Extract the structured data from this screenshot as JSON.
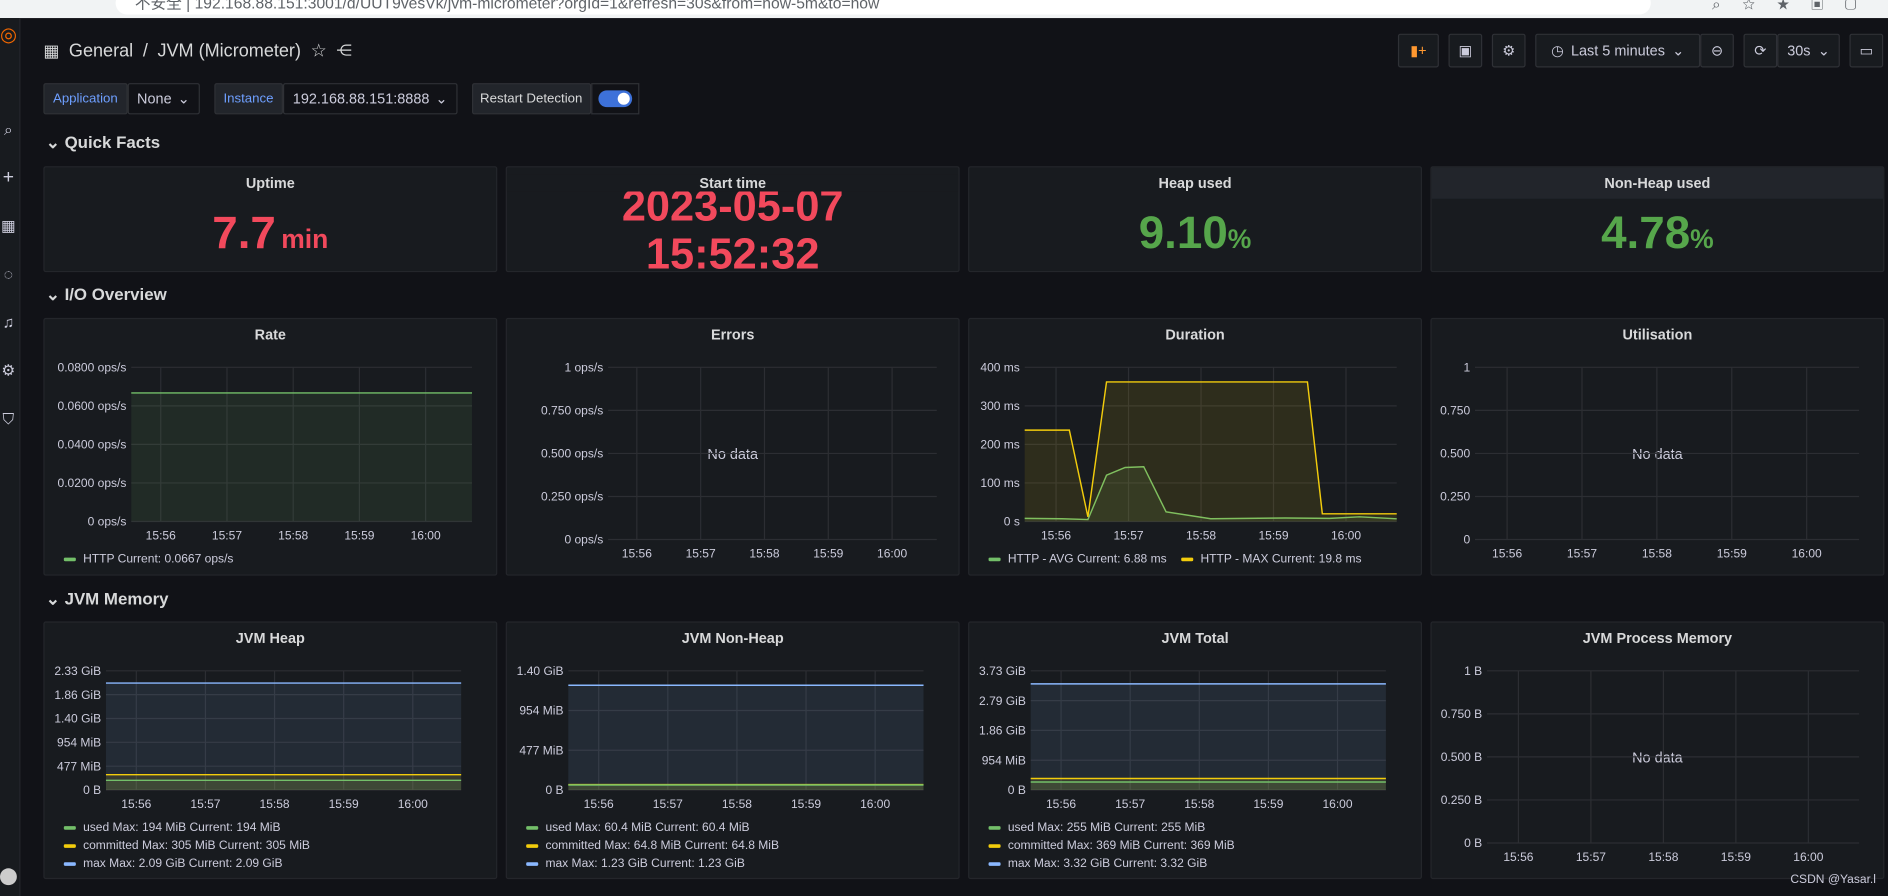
{
  "browser": {
    "url_text": "不安全 | 192.168.88.151:3001/d/UUT9vesVk/jvm-micrometer?orgId=1&refresh=30s&from=now-5m&to=now"
  },
  "sidebar_icons": [
    "grafana-logo-icon",
    "search-icon",
    "plus-icon",
    "dashboards-icon",
    "explore-icon",
    "alerting-icon",
    "settings-icon",
    "shield-icon"
  ],
  "header": {
    "folder": "General",
    "separator": "/",
    "title": "JVM (Micrometer)",
    "time_range": "Last 5 minutes",
    "refresh": "30s"
  },
  "variables": [
    {
      "label": "Application",
      "value": "None"
    },
    {
      "label": "Instance",
      "value": "192.168.88.151:8888"
    }
  ],
  "restart_detection": {
    "label": "Restart Detection",
    "enabled": true
  },
  "rows": {
    "quick_facts": "Quick Facts",
    "io": "I/O Overview",
    "memory": "JVM Memory"
  },
  "quick_facts": [
    {
      "title": "Uptime",
      "value": "7.7",
      "unit": "min",
      "color": "#f2495c"
    },
    {
      "title": "Start time",
      "value_line1": "2023-05-07",
      "value_line2": "15:52:32",
      "color": "#f2495c"
    },
    {
      "title": "Heap used",
      "value": "9.10",
      "unit": "%",
      "color": "#56a64b"
    },
    {
      "title": "Non-Heap used",
      "value": "4.78",
      "unit": "%",
      "color": "#56a64b"
    }
  ],
  "no_data_text": "No data",
  "colors": {
    "green": "#73bf69",
    "yellow": "#f2cc0c",
    "cyan": "#8ab8ff",
    "red": "#f2495c"
  },
  "charts": [
    {
      "id": "rate",
      "title": "Rate",
      "type": "line",
      "x_ticks": [
        "15:56",
        "15:57",
        "15:58",
        "15:59",
        "16:00"
      ],
      "y_ticks": [
        "0.0800 ops/s",
        "0.0600 ops/s",
        "0.0400 ops/s",
        "0.0200 ops/s",
        "0 ops/s"
      ],
      "ylim": [
        0,
        0.08
      ],
      "series": [
        {
          "name": "HTTP",
          "legend": "HTTP  Current: 0.0667 ops/s",
          "color": "#73bf69",
          "fill": true,
          "points": [
            [
              0,
              0.0667
            ],
            [
              1,
              0.0667
            ]
          ]
        }
      ]
    },
    {
      "id": "errors",
      "title": "Errors",
      "type": "line",
      "nodata": true,
      "x_ticks": [
        "15:56",
        "15:57",
        "15:58",
        "15:59",
        "16:00"
      ],
      "y_ticks": [
        "1 ops/s",
        "0.750 ops/s",
        "0.500 ops/s",
        "0.250 ops/s",
        "0 ops/s"
      ],
      "series": []
    },
    {
      "id": "duration",
      "title": "Duration",
      "type": "line",
      "x_ticks": [
        "15:56",
        "15:57",
        "15:58",
        "15:59",
        "16:00"
      ],
      "y_ticks": [
        "400 ms",
        "300 ms",
        "200 ms",
        "100 ms",
        "0 s"
      ],
      "ylim": [
        0,
        400
      ],
      "series": [
        {
          "name": "HTTP - AVG",
          "legend": "HTTP - AVG  Current: 6.88 ms",
          "color": "#73bf69",
          "fill": true,
          "points": [
            [
              0,
              8
            ],
            [
              0.1,
              7
            ],
            [
              0.17,
              5
            ],
            [
              0.22,
              120
            ],
            [
              0.27,
              140
            ],
            [
              0.32,
              142
            ],
            [
              0.38,
              25
            ],
            [
              0.5,
              7
            ],
            [
              0.7,
              9
            ],
            [
              0.82,
              8
            ],
            [
              0.9,
              12
            ],
            [
              1,
              6.88
            ]
          ]
        },
        {
          "name": "HTTP - MAX",
          "legend": "HTTP - MAX  Current: 19.8 ms",
          "color": "#f2cc0c",
          "fill": true,
          "points": [
            [
              0,
              237
            ],
            [
              0.12,
              237
            ],
            [
              0.17,
              12
            ],
            [
              0.22,
              362
            ],
            [
              0.76,
              362
            ],
            [
              0.8,
              20
            ],
            [
              1,
              19.8
            ]
          ]
        }
      ]
    },
    {
      "id": "utilisation",
      "title": "Utilisation",
      "type": "line",
      "nodata": true,
      "x_ticks": [
        "15:56",
        "15:57",
        "15:58",
        "15:59",
        "16:00"
      ],
      "y_ticks": [
        "1",
        "0.750",
        "0.500",
        "0.250",
        "0"
      ],
      "series": []
    },
    {
      "id": "jvm_heap",
      "title": "JVM Heap",
      "type": "area",
      "x_ticks": [
        "15:56",
        "15:57",
        "15:58",
        "15:59",
        "16:00"
      ],
      "y_ticks": [
        "2.33 GiB",
        "1.86 GiB",
        "1.40 GiB",
        "954 MiB",
        "477 MiB",
        "0 B"
      ],
      "ylim": [
        0,
        2.33
      ],
      "series": [
        {
          "name": "used",
          "legend": "used  Max: 194 MiB  Current: 194 MiB",
          "color": "#73bf69",
          "value": 0.19
        },
        {
          "name": "committed",
          "legend": "committed  Max: 305 MiB  Current: 305 MiB",
          "color": "#f2cc0c",
          "value": 0.3
        },
        {
          "name": "max",
          "legend": "max  Max: 2.09 GiB  Current: 2.09 GiB",
          "color": "#8ab8ff",
          "value": 2.09
        }
      ]
    },
    {
      "id": "jvm_nonheap",
      "title": "JVM Non-Heap",
      "type": "area",
      "x_ticks": [
        "15:56",
        "15:57",
        "15:58",
        "15:59",
        "16:00"
      ],
      "y_ticks": [
        "1.40 GiB",
        "954 MiB",
        "477 MiB",
        "0 B"
      ],
      "ylim": [
        0,
        1.4
      ],
      "series": [
        {
          "name": "used",
          "legend": "used  Max: 60.4 MiB  Current: 60.4 MiB",
          "color": "#73bf69",
          "value": 0.059
        },
        {
          "name": "committed",
          "legend": "committed  Max: 64.8 MiB  Current: 64.8 MiB",
          "color": "#f2cc0c",
          "value": 0.063
        },
        {
          "name": "max",
          "legend": "max  Max: 1.23 GiB  Current: 1.23 GiB",
          "color": "#8ab8ff",
          "value": 1.23
        }
      ]
    },
    {
      "id": "jvm_total",
      "title": "JVM Total",
      "type": "area",
      "x_ticks": [
        "15:56",
        "15:57",
        "15:58",
        "15:59",
        "16:00"
      ],
      "y_ticks": [
        "3.73 GiB",
        "2.79 GiB",
        "1.86 GiB",
        "954 MiB",
        "0 B"
      ],
      "ylim": [
        0,
        3.73
      ],
      "series": [
        {
          "name": "used",
          "legend": "used  Max: 255 MiB  Current: 255 MiB",
          "color": "#73bf69",
          "value": 0.25
        },
        {
          "name": "committed",
          "legend": "committed  Max: 369 MiB  Current: 369 MiB",
          "color": "#f2cc0c",
          "value": 0.36
        },
        {
          "name": "max",
          "legend": "max  Max: 3.32 GiB  Current: 3.32 GiB",
          "color": "#8ab8ff",
          "value": 3.32
        }
      ]
    },
    {
      "id": "jvm_process",
      "title": "JVM Process Memory",
      "type": "line",
      "nodata": true,
      "x_ticks": [
        "15:56",
        "15:57",
        "15:58",
        "15:59",
        "16:00"
      ],
      "y_ticks": [
        "1 B",
        "0.750 B",
        "0.500 B",
        "0.250 B",
        "0 B"
      ],
      "series": []
    }
  ],
  "watermark": "CSDN @Yasar.l"
}
